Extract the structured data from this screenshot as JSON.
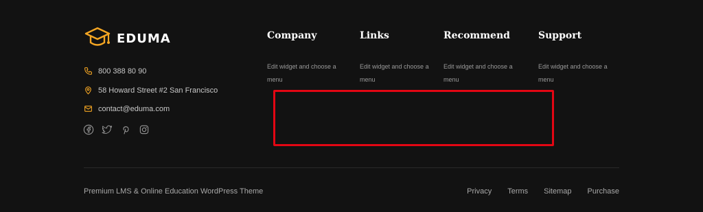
{
  "brand": {
    "name": "EDUMA",
    "accent": "#f5a623"
  },
  "contact": {
    "phone": "800 388 80 90",
    "address": "58 Howard Street #2 San Francisco",
    "email": "contact@eduma.com"
  },
  "socials": [
    "facebook-icon",
    "twitter-icon",
    "pinterest-icon",
    "instagram-icon"
  ],
  "columns": [
    {
      "title": "Company",
      "text": "Edit widget and choose a menu"
    },
    {
      "title": "Links",
      "text": "Edit widget and choose a menu"
    },
    {
      "title": "Recommend",
      "text": "Edit widget and choose a menu"
    },
    {
      "title": "Support",
      "text": "Edit widget and choose a menu"
    }
  ],
  "highlight_color": "#e30613",
  "footer": {
    "tagline": "Premium LMS & Online Education WordPress Theme",
    "links": [
      "Privacy",
      "Terms",
      "Sitemap",
      "Purchase"
    ]
  }
}
